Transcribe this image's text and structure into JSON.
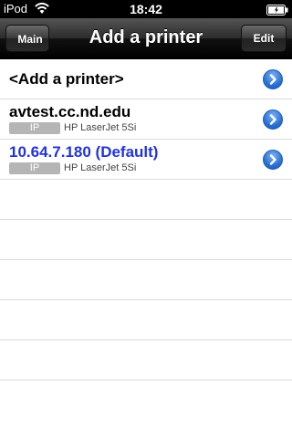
{
  "status_bar": {
    "carrier": "iPod",
    "time": "18:42"
  },
  "nav": {
    "back_label": "Main",
    "title": "Add a printer",
    "edit_label": "Edit"
  },
  "printers": [
    {
      "title": "<Add a printer>"
    },
    {
      "title": "avtest.cc.nd.edu",
      "badge": "IP",
      "model": "HP LaserJet 5Si"
    },
    {
      "title": "10.64.7.180 (Default)",
      "badge": "IP",
      "model": "HP LaserJet 5Si"
    }
  ],
  "colors": {
    "default_title": "#2233dd",
    "disclosure_blue": "#2a70d6"
  }
}
